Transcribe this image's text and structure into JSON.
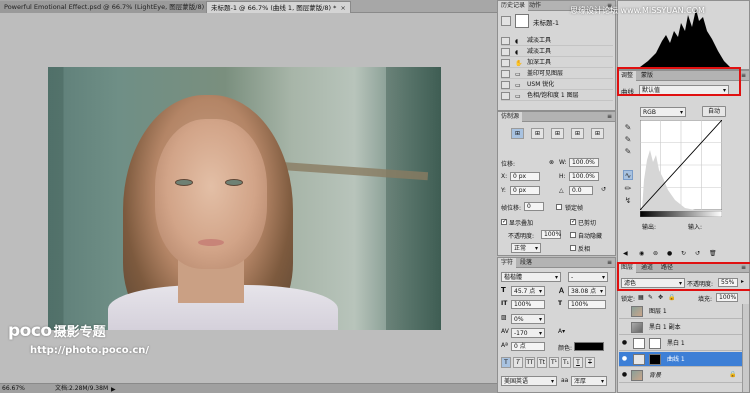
{
  "document": {
    "tabs": [
      {
        "label": "Powerful Emotional Effect.psd @ 66.7% (LightEye, 图层蒙版/8) *",
        "close": "×"
      },
      {
        "label": "未标题-1 @ 66.7% (曲线 1, 图层蒙版/8) *",
        "close": "×"
      }
    ],
    "status": {
      "zoom": "66.67%",
      "doc_info": "文档:2.28M/9.38M",
      "arrow": "▶"
    },
    "watermark": {
      "brand": "poco",
      "cn": "摄影专题",
      "url": "http://photo.poco.cn/"
    }
  },
  "site_watermark": "思缘设计论坛 www.MISSYUAN.COM",
  "history": {
    "tabs": [
      "历史记录",
      "动作"
    ],
    "snapshot": "未标题-1",
    "items": [
      {
        "label": "减淡工具",
        "icon": "dodge-icon"
      },
      {
        "label": "减淡工具",
        "icon": "dodge-icon"
      },
      {
        "label": "加深工具",
        "icon": "burn-icon"
      },
      {
        "label": "盖印可见图层",
        "icon": "layer-icon"
      },
      {
        "label": "USM 锐化",
        "icon": "filter-icon"
      },
      {
        "label": "色相/饱和度 1 图层",
        "icon": "adjust-icon"
      }
    ]
  },
  "adjustments": {
    "tabs": [
      "调整",
      "蒙版"
    ],
    "type_label": "曲线",
    "preset": "默认值",
    "channel": "RGB",
    "auto_button": "自动",
    "output_label": "输出:",
    "input_label": "输入:"
  },
  "transform": {
    "title": "仿制源",
    "offset_label": "位移:",
    "x": "0 px",
    "y": "0 px",
    "w": "100.0%",
    "h": "100.0%",
    "angle": "0.0",
    "frame_offset_label": "帧位移:",
    "frame_offset": "0",
    "lock_frame": "锁定帧",
    "show_overlay": "显示叠加",
    "opacity_label": "不透明度:",
    "opacity": "100%",
    "blend": "正常",
    "clipped": "已剪切",
    "auto_hide": "自动隐藏",
    "invert": "反相"
  },
  "character": {
    "tabs": [
      "字符",
      "段落"
    ],
    "font": "楷楷體",
    "style": "-",
    "size": "45.7 点",
    "leading": "38.08 点",
    "vscale": "100%",
    "hscale": "100%",
    "tracking_pct": "0%",
    "kerning": "-170",
    "baseline": "0 点",
    "color_label": "颜色:",
    "language": "美国英语",
    "antialias": "浑厚",
    "aa_prefix": "aa"
  },
  "layers": {
    "tabs": [
      "图层",
      "通道",
      "路径"
    ],
    "blend_mode": "滤色",
    "opacity_label": "不透明度:",
    "opacity": "55%",
    "lock_label": "锁定:",
    "fill_label": "填充:",
    "fill": "100%",
    "items": [
      {
        "name": "图层 1",
        "selected": false
      },
      {
        "name": "黑白 1 副本",
        "selected": false
      },
      {
        "name": "黑白 1",
        "selected": false
      },
      {
        "name": "曲线 1",
        "selected": true
      },
      {
        "name": "背景",
        "selected": false
      }
    ]
  },
  "colors": {
    "red_highlight": "#e01010",
    "selection": "#3d7fd6"
  }
}
